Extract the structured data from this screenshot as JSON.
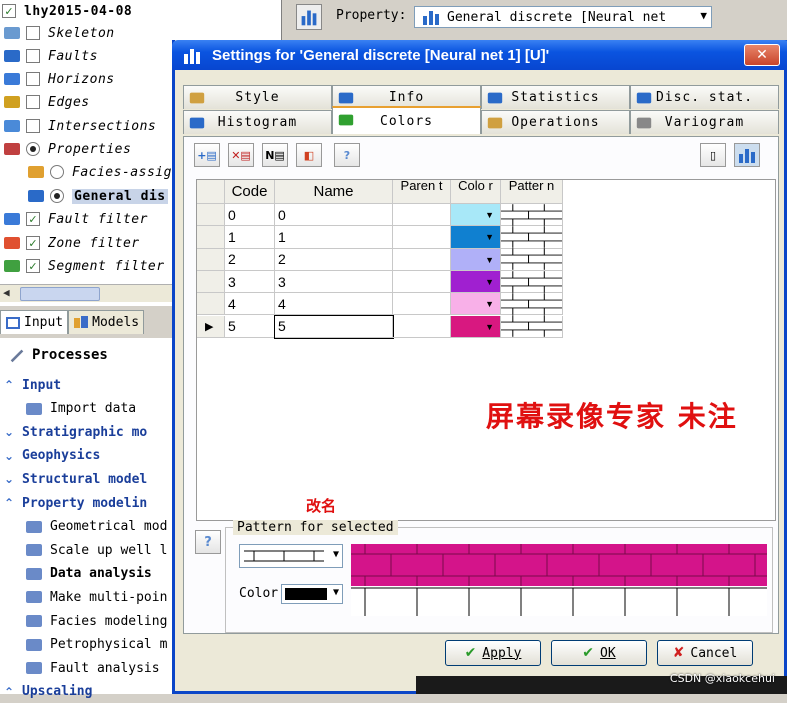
{
  "tree": {
    "root": "lhy2015-04-08",
    "items": [
      {
        "label": "Skeleton",
        "icon": "skeleton-icon",
        "color": "#6a9ad0"
      },
      {
        "label": "Faults",
        "icon": "faults-icon",
        "color": "#2a6ac8"
      },
      {
        "label": "Horizons",
        "icon": "horizons-icon",
        "color": "#3a7ad8"
      },
      {
        "label": "Edges",
        "icon": "edges-icon",
        "color": "#d0a020"
      },
      {
        "label": "Intersections",
        "icon": "intersections-icon",
        "color": "#4a8ad8"
      },
      {
        "label": "Properties",
        "icon": "properties-icon",
        "color": "#c04040"
      },
      {
        "label": "Facies-assig",
        "icon": "facies-icon",
        "color": "#e0a030"
      },
      {
        "label": "General dis",
        "icon": "bar-chart-icon",
        "color": "#2a6ac8"
      },
      {
        "label": "Fault filter",
        "icon": "fault-filter-icon",
        "color": "#3a7ad8"
      },
      {
        "label": "Zone filter",
        "icon": "zone-filter-icon",
        "color": "#e05030"
      },
      {
        "label": "Segment filter",
        "icon": "segment-filter-icon",
        "color": "#40a040"
      }
    ]
  },
  "left_tabs": [
    "Input",
    "Models"
  ],
  "processes": {
    "title": "Processes",
    "rows": [
      {
        "type": "cat",
        "label": "Input",
        "chev": "up"
      },
      {
        "type": "item",
        "label": "Import data"
      },
      {
        "type": "cat",
        "label": "Stratigraphic mo",
        "chev": "down"
      },
      {
        "type": "cat",
        "label": "Geophysics",
        "chev": "down"
      },
      {
        "type": "cat",
        "label": "Structural model",
        "chev": "down"
      },
      {
        "type": "cat",
        "label": "Property modelin",
        "chev": "up"
      },
      {
        "type": "item",
        "label": "Geometrical mod"
      },
      {
        "type": "item",
        "label": "Scale up well l"
      },
      {
        "type": "item",
        "label": "Data analysis",
        "bold": true
      },
      {
        "type": "item",
        "label": "Make multi-poin"
      },
      {
        "type": "item",
        "label": "Facies modeling"
      },
      {
        "type": "item",
        "label": "Petrophysical m"
      },
      {
        "type": "item",
        "label": "Fault analysis"
      },
      {
        "type": "cat",
        "label": "Upscaling",
        "chev": "up"
      }
    ]
  },
  "property_bar": {
    "label": "Property:",
    "value": "General discrete [Neural net"
  },
  "dialog": {
    "title": "Settings for 'General discrete [Neural net 1] [U]'",
    "tabs_row1": [
      "Style",
      "Info",
      "Statistics",
      "Disc. stat."
    ],
    "tabs_row2": [
      "Histogram",
      "Colors",
      "Operations",
      "Variogram"
    ],
    "active_tab": "Colors",
    "columns": [
      "Code",
      "Name",
      "Paren t",
      "Colo r",
      "Patter n"
    ],
    "rows": [
      {
        "code": "0",
        "name": "0",
        "color": "#a8e8f8"
      },
      {
        "code": "1",
        "name": "1",
        "color": "#1080d0"
      },
      {
        "code": "2",
        "name": "2",
        "color": "#b0b0f8"
      },
      {
        "code": "3",
        "name": "3",
        "color": "#a020d0"
      },
      {
        "code": "4",
        "name": "4",
        "color": "#f8b0e8"
      },
      {
        "code": "5",
        "name": "5",
        "color": "#d81880"
      }
    ],
    "pattern_label": "Pattern for selected",
    "color_label": "Color",
    "buttons": {
      "apply": "Apply",
      "ok": "OK",
      "cancel": "Cancel"
    },
    "help": "?"
  },
  "overlay": {
    "watermark": "屏幕录像专家  未注",
    "annotation": "改名",
    "credit": "CSDN @xiaokcehui"
  }
}
